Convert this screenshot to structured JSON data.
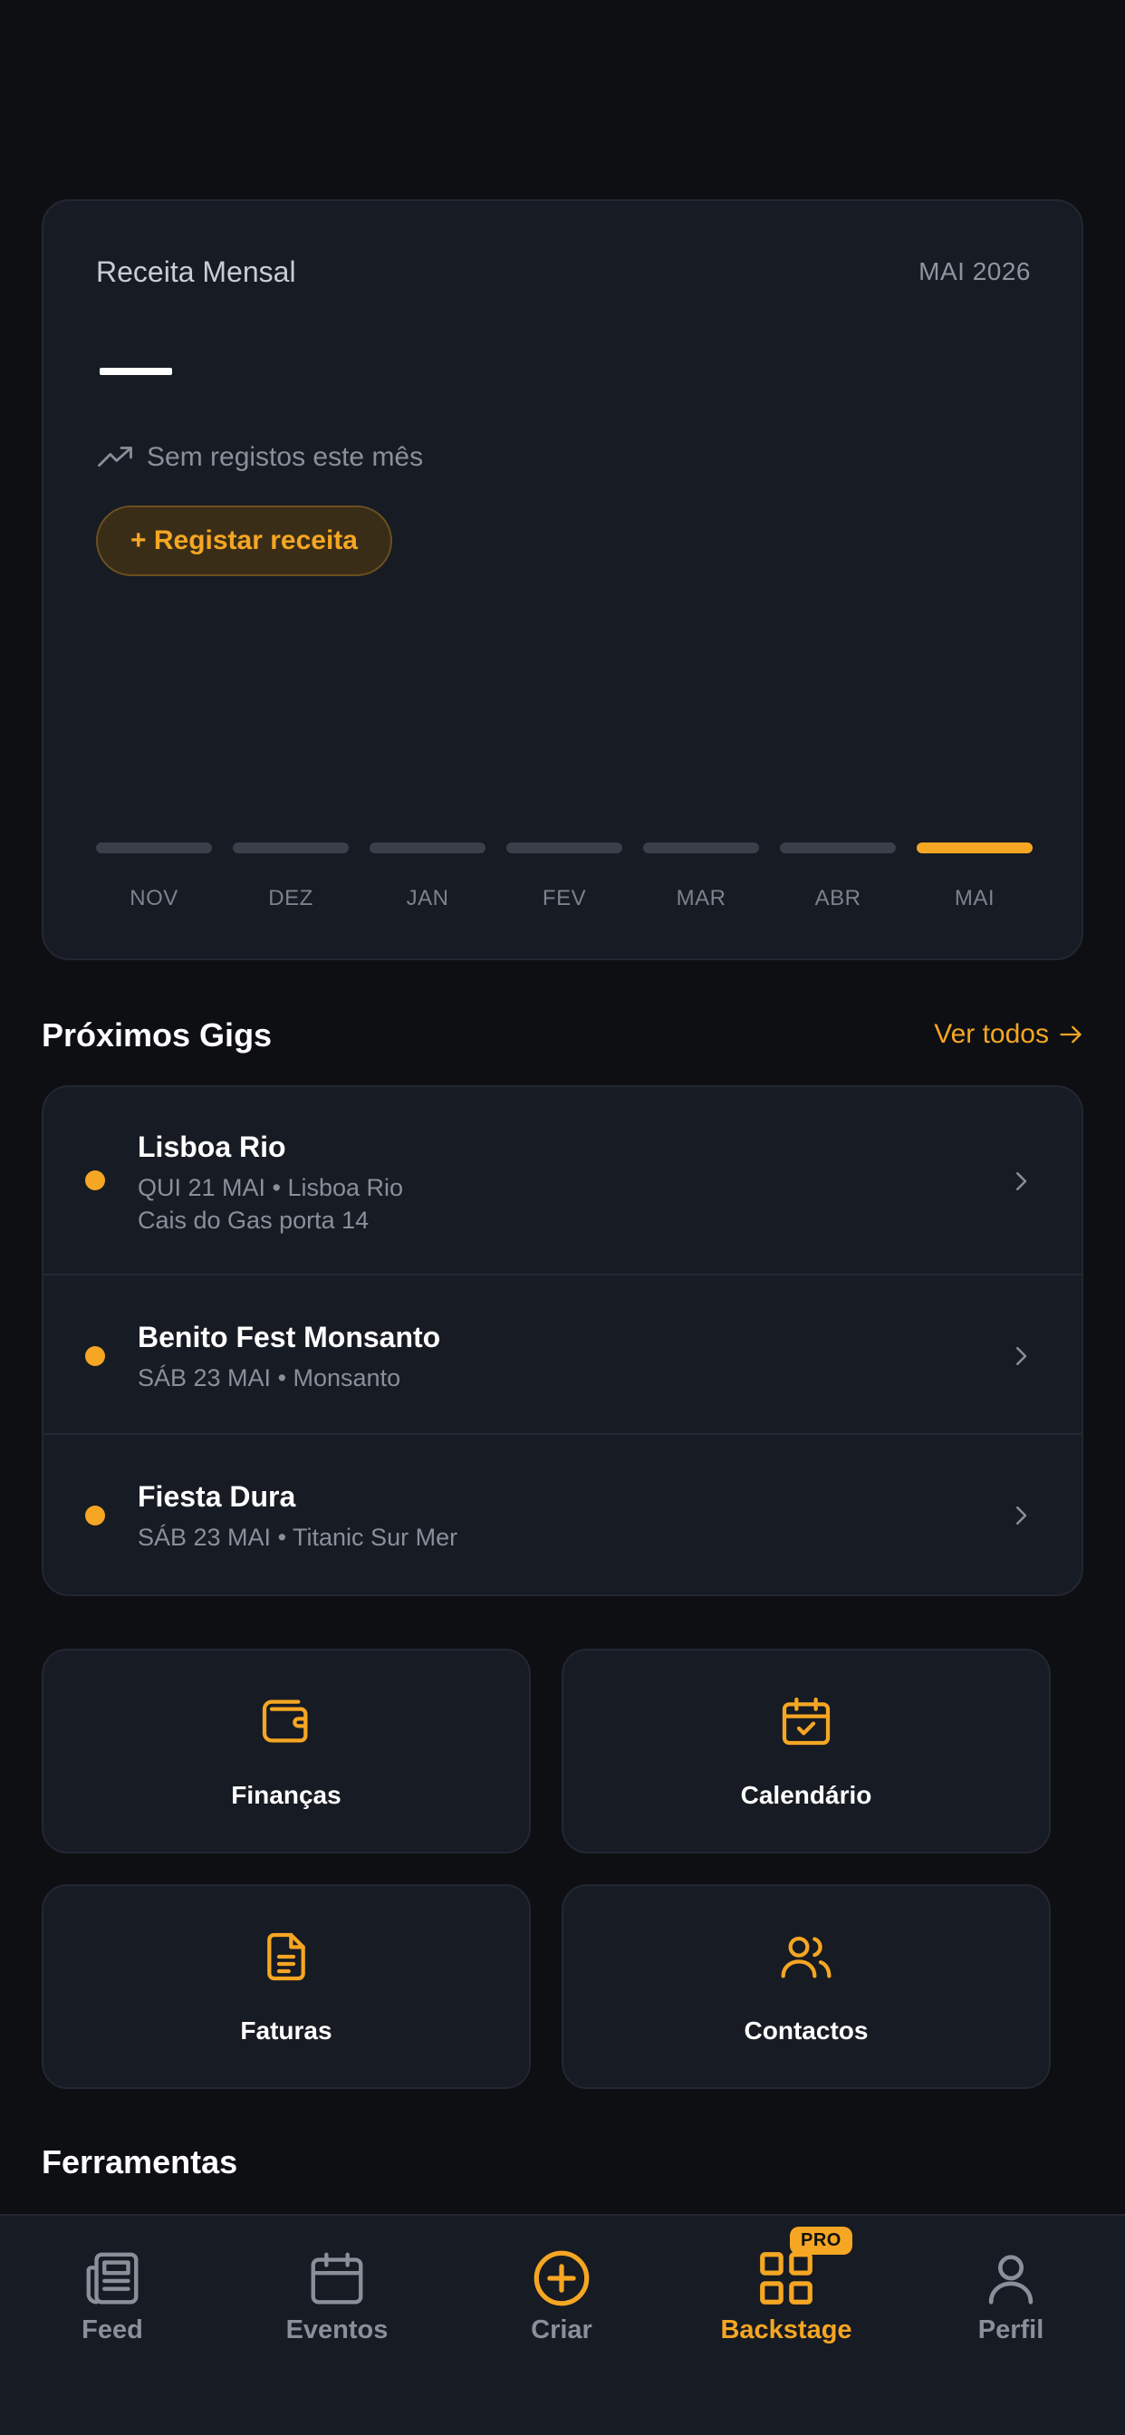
{
  "revenue": {
    "title": "Receita Mensal",
    "period": "MAI 2026",
    "value": "",
    "status": "Sem registos este mês",
    "add_button": "+ Registar receita",
    "months": [
      {
        "label": "NOV",
        "active": false
      },
      {
        "label": "DEZ",
        "active": false
      },
      {
        "label": "JAN",
        "active": false
      },
      {
        "label": "FEV",
        "active": false
      },
      {
        "label": "MAR",
        "active": false
      },
      {
        "label": "ABR",
        "active": false
      },
      {
        "label": "MAI",
        "active": true
      }
    ]
  },
  "gigs": {
    "title": "Próximos Gigs",
    "see_all": "Ver todos",
    "items": [
      {
        "name": "Lisboa Rio",
        "line1": "QUI 21 MAI • Lisboa Rio",
        "line2": "Cais do Gas porta 14"
      },
      {
        "name": "Benito Fest Monsanto",
        "line1": "SÁB 23 MAI • Monsanto",
        "line2": ""
      },
      {
        "name": "Fiesta Dura",
        "line1": "SÁB 23 MAI • Titanic Sur Mer",
        "line2": ""
      }
    ]
  },
  "tiles": [
    {
      "label": "Finanças",
      "icon": "wallet-icon"
    },
    {
      "label": "Calendário",
      "icon": "calendar-check-icon"
    },
    {
      "label": "Faturas",
      "icon": "document-icon"
    },
    {
      "label": "Contactos",
      "icon": "users-icon"
    }
  ],
  "tools": {
    "title": "Ferramentas"
  },
  "tabbar": {
    "items": [
      {
        "label": "Feed",
        "icon": "newspaper-icon",
        "active": false
      },
      {
        "label": "Eventos",
        "icon": "calendar-icon",
        "active": false
      },
      {
        "label": "Criar",
        "icon": "plus-circle-icon",
        "active": false
      },
      {
        "label": "Backstage",
        "icon": "grid-icon",
        "active": true,
        "badge": "PRO"
      },
      {
        "label": "Perfil",
        "icon": "person-icon",
        "active": false
      }
    ]
  },
  "colors": {
    "background": "#0d0f13",
    "card": "#171b23",
    "accent": "#f5a623",
    "muted": "#8a8f99"
  }
}
